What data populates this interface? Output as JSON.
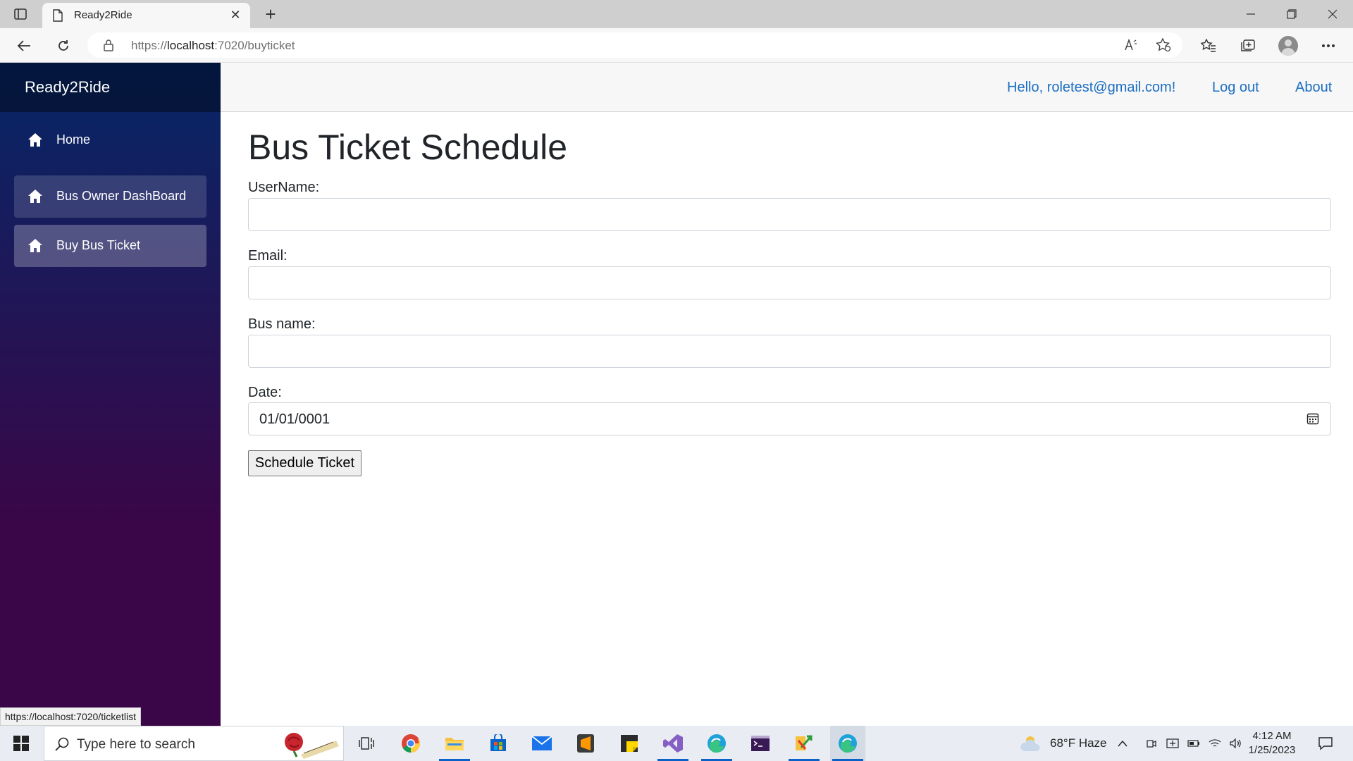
{
  "browser": {
    "tab_title": "Ready2Ride",
    "url_prefix": "https://",
    "url_host": "localhost",
    "url_path": ":7020/buyticket",
    "status_url": "https://localhost:7020/ticketlist"
  },
  "app": {
    "brand": "Ready2Ride",
    "sidebar": {
      "items": [
        {
          "label": "Home",
          "icon": "home-icon"
        },
        {
          "label": "Bus Owner DashBoard",
          "icon": "home-icon"
        },
        {
          "label": "Buy Bus Ticket",
          "icon": "home-icon"
        }
      ]
    },
    "top_links": {
      "greeting": "Hello, roletest@gmail.com!",
      "logout": "Log out",
      "about": "About"
    },
    "accent_color": "#1b6ec2"
  },
  "form": {
    "title": "Bus Ticket Schedule",
    "username_label": "UserName:",
    "username_value": "",
    "email_label": "Email:",
    "email_value": "",
    "busname_label": "Bus name:",
    "busname_value": "",
    "date_label": "Date:",
    "date_value": "01/01/0001",
    "submit_label": "Schedule Ticket"
  },
  "taskbar": {
    "search_placeholder": "Type here to search",
    "weather": "68°F  Haze",
    "time": "4:12 AM",
    "date": "1/25/2023"
  }
}
